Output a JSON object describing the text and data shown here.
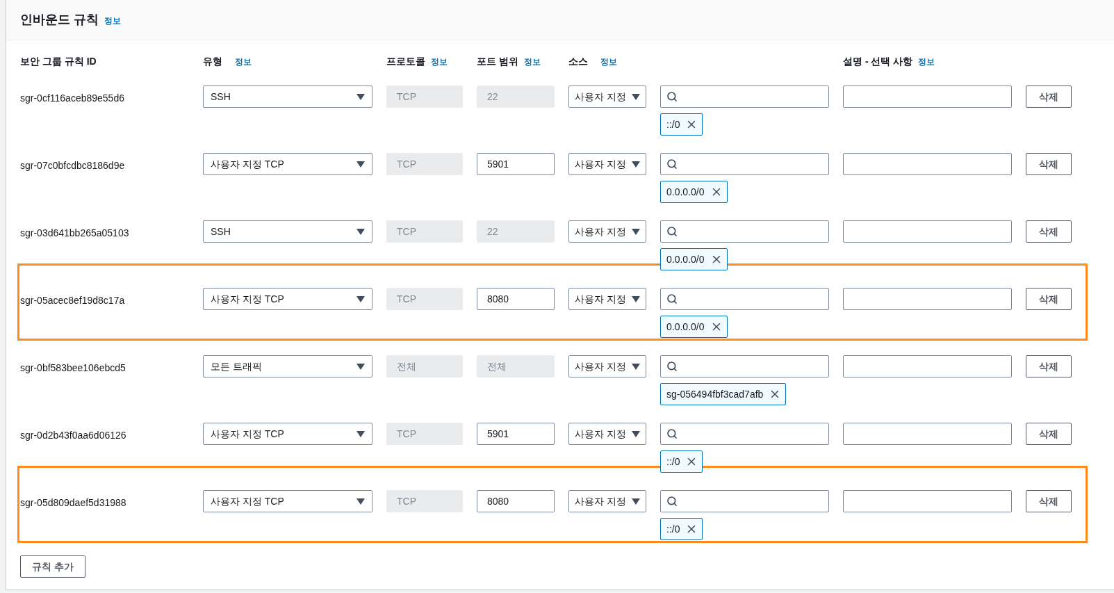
{
  "section": {
    "title": "인바운드 규칙",
    "info_link": "정보"
  },
  "columns": [
    {
      "label": "보안 그룹 규칙 ID"
    },
    {
      "label": "유형",
      "info": "정보"
    },
    {
      "label": "프로토콜",
      "info": "정보"
    },
    {
      "label": "포트 범위",
      "info": "정보"
    },
    {
      "label": "소스",
      "info": "정보"
    },
    {
      "label": "설명 - 선택 사항",
      "info": "정보"
    }
  ],
  "rows": [
    {
      "id": "sgr-0cf116aceb89e55d6",
      "type": "SSH",
      "protocol": {
        "value": "TCP",
        "disabled": true
      },
      "port": {
        "value": "22",
        "disabled": true
      },
      "source": "사용자 지정",
      "tokens": [
        "::/0"
      ],
      "delete": "삭제",
      "highlighted": false
    },
    {
      "id": "sgr-07c0bfcdbc8186d9e",
      "type": "사용자 지정 TCP",
      "protocol": {
        "value": "TCP",
        "disabled": true
      },
      "port": {
        "value": "5901",
        "disabled": false
      },
      "source": "사용자 지정",
      "tokens": [
        "0.0.0.0/0"
      ],
      "delete": "삭제",
      "highlighted": false
    },
    {
      "id": "sgr-03d641bb265a05103",
      "type": "SSH",
      "protocol": {
        "value": "TCP",
        "disabled": true
      },
      "port": {
        "value": "22",
        "disabled": true
      },
      "source": "사용자 지정",
      "tokens": [
        "0.0.0.0/0"
      ],
      "delete": "삭제",
      "highlighted": false
    },
    {
      "id": "sgr-05acec8ef19d8c17a",
      "type": "사용자 지정 TCP",
      "protocol": {
        "value": "TCP",
        "disabled": true
      },
      "port": {
        "value": "8080",
        "disabled": false
      },
      "source": "사용자 지정",
      "tokens": [
        "0.0.0.0/0"
      ],
      "delete": "삭제",
      "highlighted": true
    },
    {
      "id": "sgr-0bf583bee106ebcd5",
      "type": "모든 트래픽",
      "protocol": {
        "value": "전체",
        "disabled": true
      },
      "port": {
        "value": "전체",
        "disabled": true
      },
      "source": "사용자 지정",
      "tokens": [
        "sg-056494fbf3cad7afb"
      ],
      "delete": "삭제",
      "highlighted": false
    },
    {
      "id": "sgr-0d2b43f0aa6d06126",
      "type": "사용자 지정 TCP",
      "protocol": {
        "value": "TCP",
        "disabled": true
      },
      "port": {
        "value": "5901",
        "disabled": false
      },
      "source": "사용자 지정",
      "tokens": [
        "::/0"
      ],
      "delete": "삭제",
      "highlighted": false
    },
    {
      "id": "sgr-05d809daef5d31988",
      "type": "사용자 지정 TCP",
      "protocol": {
        "value": "TCP",
        "disabled": true
      },
      "port": {
        "value": "8080",
        "disabled": false
      },
      "source": "사용자 지정",
      "tokens": [
        "::/0"
      ],
      "delete": "삭제",
      "highlighted": true
    }
  ],
  "add_button": "규칙 추가"
}
